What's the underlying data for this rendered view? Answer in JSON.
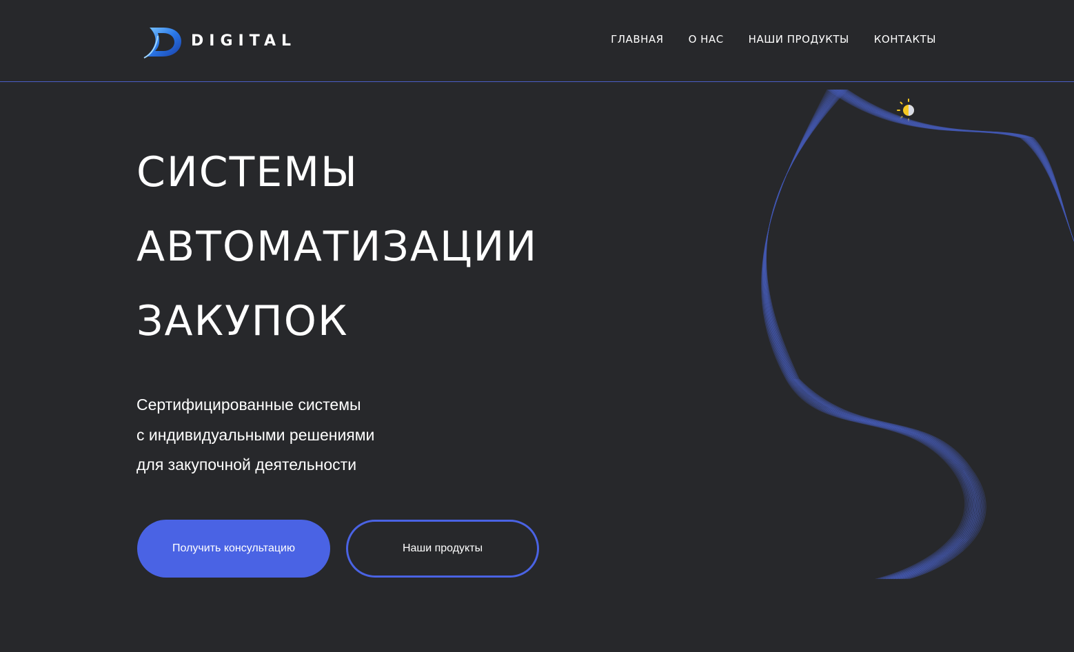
{
  "header": {
    "logo_text": "DIGITAL",
    "nav": [
      {
        "label": "ГЛАВНАЯ"
      },
      {
        "label": "О НАС"
      },
      {
        "label": "НАШИ ПРОДУКТЫ"
      },
      {
        "label": "КОНТАКТЫ"
      }
    ]
  },
  "hero": {
    "title_lines": [
      "СИСТЕМЫ",
      "АВТОМАТИЗАЦИИ",
      "ЗАКУПОК"
    ],
    "subtitle_lines": [
      "Сертифицированные системы",
      "с индивидуальными решениями",
      "для закупочной деятельности"
    ],
    "primary_button": "Получить консультацию",
    "secondary_button": "Наши продукты"
  },
  "icons": {
    "logo": "digital-logo-icon",
    "theme_toggle": "sun-moon-icon"
  },
  "colors": {
    "background": "#27282b",
    "accent": "#4a63e4",
    "divider": "#4a5fc6",
    "toggle_sun": "#f6c922"
  }
}
